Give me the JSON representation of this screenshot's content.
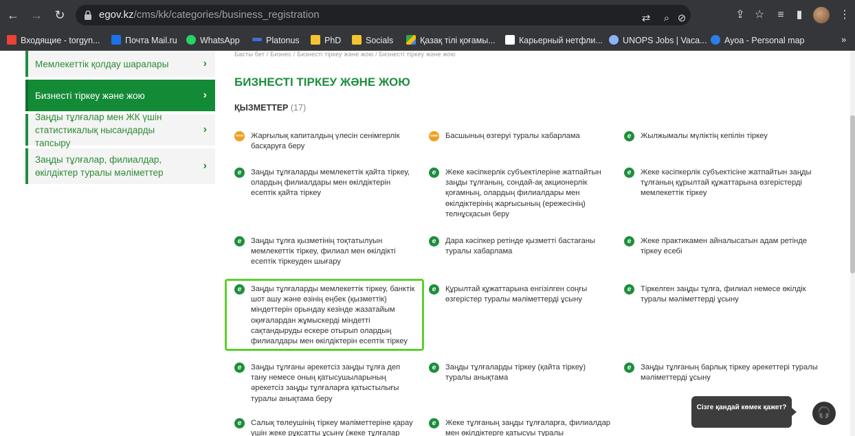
{
  "browser": {
    "url_host": "egov.kz",
    "url_path": "/cms/kk/categories/business_registration",
    "bookmarks": [
      {
        "label": "Входящие - torgyn...",
        "color": "#ea4335"
      },
      {
        "label": "Почта Mail.ru",
        "color": "#1a73e8"
      },
      {
        "label": "WhatsApp",
        "color": "#25d366"
      },
      {
        "label": "Platonus",
        "color": "#3c6fd8"
      },
      {
        "label": "PhD",
        "color": "#f4c430"
      },
      {
        "label": "Socials",
        "color": "#f4c430"
      },
      {
        "label": "Қазақ тілі қоғамы...",
        "color": "#34a853"
      },
      {
        "label": "Карьерный нетфли...",
        "color": "#ffffff"
      },
      {
        "label": "UNOPS Jobs | Vaca...",
        "color": "#8ab4f8"
      },
      {
        "label": "Ayoa - Personal map",
        "color": "#2b7de9"
      }
    ],
    "more": "»"
  },
  "sidebar": {
    "items": [
      {
        "label": "Мемлекеттік қолдау шаралары"
      },
      {
        "label": "Бизнесті тіркеу және жою"
      },
      {
        "label": "Заңды тұлғалар мен ЖК үшін статистикалық нысандарды тапсыру"
      },
      {
        "label": "Заңды тұлғалар, филиалдар, өкілдіктер туралы мәліметтер"
      }
    ]
  },
  "main": {
    "breadcrumb": "Басты бет / Бизнес / Бизнесті тіркеу және жою / Бизнесті тіркеу және жою",
    "title": "БИЗНЕСТІ ТІРКЕУ ЖӘНЕ ЖОЮ",
    "services_label": "ҚЫЗМЕТТЕР",
    "services_count": "(17)",
    "services": [
      {
        "badge": "new",
        "text": "Жарғылық капиталдың үлесін сенімгерлік басқаруға беру"
      },
      {
        "badge": "new",
        "text": "Басшының өзгеруі туралы хабарлама"
      },
      {
        "badge": "e",
        "text": "Жылжымалы мүліктің кепілін тіркеу"
      },
      {
        "badge": "e",
        "text": "Заңды тұлғаларды мемлекеттік қайта тіркеу, олардың филиалдары мен өкілдіктерін есептік қайта тіркеу"
      },
      {
        "badge": "e",
        "text": "Жеке кәсіпкерлік субъектілеріне жатпайтын заңды тұлғаның, сондай-ақ акционерлік қоғамның, олардың филиалдары мен өкілдіктерінің жарғысының (ережесінің) телнұсқасын беру"
      },
      {
        "badge": "e",
        "text": "Жеке кәсіпкерлік субъектісіне жатпайтын заңды тұлғаның құрылтай құжаттарына өзгерістерді мемлекеттік тіркеу"
      },
      {
        "badge": "e",
        "text": "Заңды тұлға қызметінің тоқтатылуын мемлекеттік тіркеу, филиал мен өкілдікті есептік тіркеуден шығару"
      },
      {
        "badge": "e",
        "text": "Дара кәсіпкер ретінде қызметті бастағаны туралы хабарлама"
      },
      {
        "badge": "e",
        "text": "Жеке практикамен айналысатын адам ретінде тіркеу есебі"
      },
      {
        "badge": "e",
        "text": "Заңды тұлғаларды мемлекеттік тіркеу, банктік шот ашу және өзінің еңбек (қызметтік) міндеттерін орындау кезінде жазатайым оқиғалардан жұмыскерді міндетті сақтандыруды ескере отырып олардың филиалдары мен өкілдіктерін есептік тіркеу"
      },
      {
        "badge": "e",
        "text": "Құрылтай құжаттарына енгізілген соңғы өзгерістер туралы мәліметтерді ұсыну"
      },
      {
        "badge": "e",
        "text": "Тіркелген заңды тұлға, филиал немесе өкілдік туралы мәліметтерді ұсыну"
      },
      {
        "badge": "e",
        "text": "Заңды тұлғаны әрекетсіз заңды тұлға деп тану немесе оның қатысушыларының әрекетсіз заңды тұлғаларға қатыстылығы туралы анықтама беру"
      },
      {
        "badge": "e",
        "text": "Заңды тұлғаларды тіркеу (қайта тіркеу) туралы анықтама"
      },
      {
        "badge": "e",
        "text": "Заңды тұлғаның барлық тіркеу әрекеттері туралы мәліметтерді ұсыну"
      },
      {
        "badge": "e",
        "text": "Салық төлеушінің тіркеу мәліметтеріне қарау үшін жеке рұқсатты ұсыну (жеке тұлғалар"
      },
      {
        "badge": "e",
        "text": "Жеке тұлғаның заңды тұлғаларға, филиалдар мен өкілдіктерге қатысуы туралы мәліметтерді"
      }
    ]
  },
  "help": {
    "bubble_text": "Сізге қандай көмек қажет?"
  },
  "colors": {
    "accent": "#1e8e3e",
    "highlight": "#5ad02a"
  }
}
